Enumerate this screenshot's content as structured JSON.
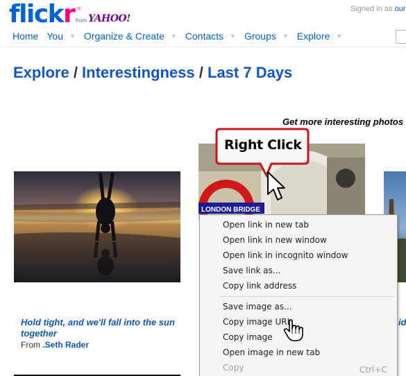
{
  "brand": {
    "logo_part1": "flick",
    "logo_part2": "r",
    "registered": "®",
    "from": "from",
    "yahoo": "YAHOO!",
    "colors": {
      "blue": "#0063dc",
      "pink": "#ff0084"
    }
  },
  "header": {
    "signed_in_prefix": "Signed in as",
    "user": "ouri"
  },
  "nav": {
    "items": [
      {
        "label": "Home",
        "has_menu": false
      },
      {
        "label": "You",
        "has_menu": true
      },
      {
        "label": "Organize & Create",
        "has_menu": true
      },
      {
        "label": "Contacts",
        "has_menu": true
      },
      {
        "label": "Groups",
        "has_menu": true
      },
      {
        "label": "Explore",
        "has_menu": true
      }
    ]
  },
  "breadcrumb": {
    "part1": "Explore",
    "sep": " / ",
    "part2": "Interestingness",
    "part3": "Last 7 Days"
  },
  "promo": "Get more interesting photos",
  "photos": {
    "photo2_sign": "LONDON BRIDGE"
  },
  "caption": {
    "title": "Hold tight, and we'll fall into the sun together",
    "from_prefix": "From",
    "author": ".Seth Rader",
    "edge_fragment": "id"
  },
  "callout": {
    "text": "Right Click"
  },
  "context_menu": {
    "items": [
      {
        "label": "Open link in new tab",
        "enabled": true
      },
      {
        "label": "Open link in new window",
        "enabled": true
      },
      {
        "label": "Open link in incognito window",
        "enabled": true
      },
      {
        "label": "Save link as...",
        "enabled": true
      },
      {
        "label": "Copy link address",
        "enabled": true
      },
      {
        "label": "Save image as...",
        "enabled": true
      },
      {
        "label": "Copy image URL",
        "enabled": true
      },
      {
        "label": "Copy image",
        "enabled": true
      },
      {
        "label": "Open image in new tab",
        "enabled": true
      },
      {
        "label": "Copy",
        "enabled": false
      }
    ],
    "copy_shortcut": "Ctrl+C"
  }
}
